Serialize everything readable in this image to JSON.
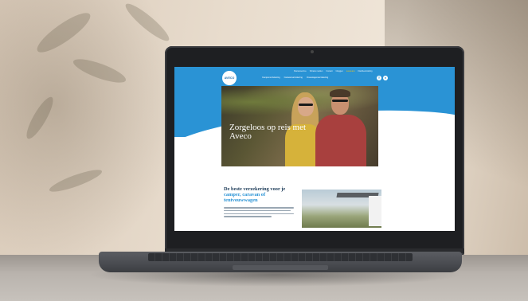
{
  "site": {
    "logo_text": "AVECO",
    "logo_sub": "",
    "topbar_items": [
      "Klantenservice",
      "Schade melden",
      "Contact",
      "Inloggen",
      "★★★★★",
      "Klantbeoordeling"
    ],
    "nav_items": [
      "Camperverzekering",
      "Caravanverzekering",
      "Vouwwagenverzekering"
    ],
    "hero_title": "Zorgeloos op reis met Aveco",
    "hero_subtitle": "",
    "section_title_part1": "De beste verzekering voor je ",
    "section_title_accent": "camper, caravan of tentvouwwagen",
    "section_title_part2": "",
    "brand_color": "#2a93d5",
    "search_icon": "search-icon",
    "user_icon": "user-icon"
  }
}
